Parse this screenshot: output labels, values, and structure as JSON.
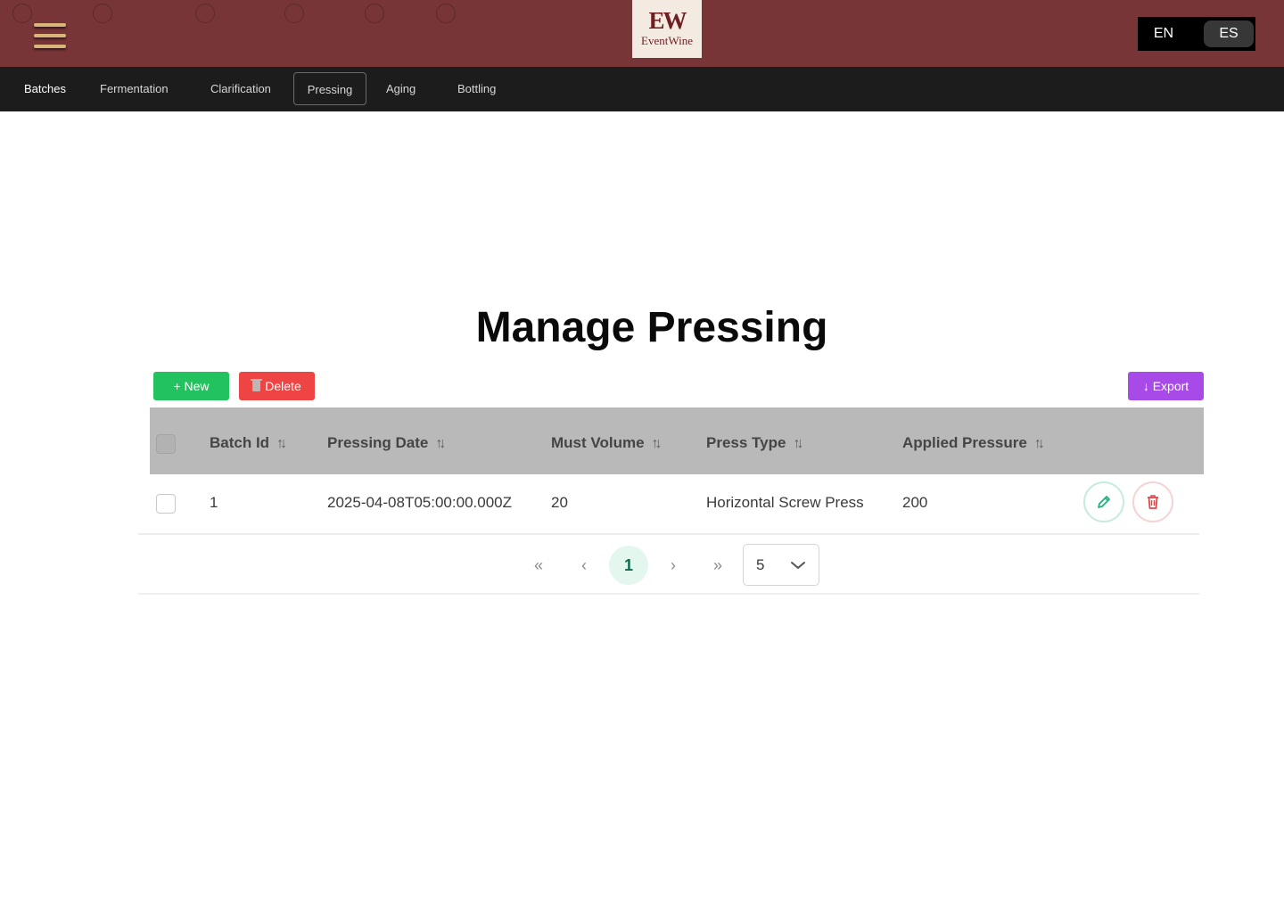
{
  "header": {
    "logo_mark": "EW",
    "logo_text": "EventWine",
    "languages": [
      "EN",
      "ES"
    ],
    "active_language": "ES"
  },
  "nav": {
    "items": [
      {
        "label": "Batches"
      },
      {
        "label": "Fermentation"
      },
      {
        "label": "Clarification"
      },
      {
        "label": "Pressing"
      },
      {
        "label": "Aging"
      },
      {
        "label": "Bottling"
      }
    ],
    "selected": "Pressing"
  },
  "page": {
    "title": "Manage Pressing"
  },
  "toolbar": {
    "new_label": "+ New",
    "delete_label": "Delete",
    "export_label": "↓ Export"
  },
  "table": {
    "columns": [
      "Batch Id",
      "Pressing Date",
      "Must Volume",
      "Press Type",
      "Applied Pressure"
    ],
    "sort_icon": "↑↓",
    "rows": [
      {
        "batch_id": "1",
        "pressing_date": "2025-04-08T05:00:00.000Z",
        "must_volume": "20",
        "press_type": "Horizontal Screw Press",
        "applied_pressure": "200"
      }
    ]
  },
  "pagination": {
    "first": "«",
    "prev": "‹",
    "current_page": "1",
    "next": "›",
    "last": "»",
    "page_size": "5"
  },
  "colors": {
    "header_bg": "#773537",
    "nav_bg": "#1c1c1c",
    "new_button": "#22c35e",
    "delete_button": "#ef4444",
    "export_button": "#a84ae8",
    "table_header_bg": "#b9b9b9"
  },
  "icons": {
    "menu": "hamburger-icon",
    "sort": "sort-arrows-icon",
    "edit": "pencil-icon",
    "delete": "trash-icon",
    "dropdown": "chevron-down-icon"
  }
}
